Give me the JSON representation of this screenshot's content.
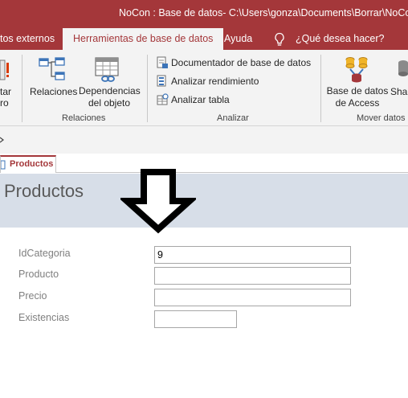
{
  "window": {
    "title": "NoCon : Base de datos- C:\\Users\\gonza\\Documents\\Borrar\\NoCon.a"
  },
  "tabs": [
    {
      "label": "tos externos"
    },
    {
      "label": "Herramientas de base de datos"
    },
    {
      "label": "Ayuda"
    },
    {
      "label": "¿Qué desea hacer?"
    }
  ],
  "ribbon": {
    "partial_button": {
      "line1": "tar",
      "line2": "ro"
    },
    "relaciones_button": "Relaciones",
    "dependencias_button": {
      "line1": "Dependencias",
      "line2": "del objeto"
    },
    "group_relaciones": "Relaciones",
    "documentador": "Documentador de base de datos",
    "analizar_rendimiento": "Analizar rendimiento",
    "analizar_tabla": "Analizar tabla",
    "group_analizar": "Analizar",
    "base_datos_access": {
      "line1": "Base de datos",
      "line2": "de Access"
    },
    "share_partial": "Shar",
    "group_mover": "Mover datos"
  },
  "document_tab": {
    "label": "Productos"
  },
  "form": {
    "title": "Productos",
    "fields": [
      {
        "label": "IdCategoria",
        "value": "9"
      },
      {
        "label": "Producto",
        "value": ""
      },
      {
        "label": "Precio",
        "value": ""
      },
      {
        "label": "Existencias",
        "value": ""
      }
    ]
  },
  "colors": {
    "accent": "#a4373a",
    "header": "#d7dee8"
  }
}
